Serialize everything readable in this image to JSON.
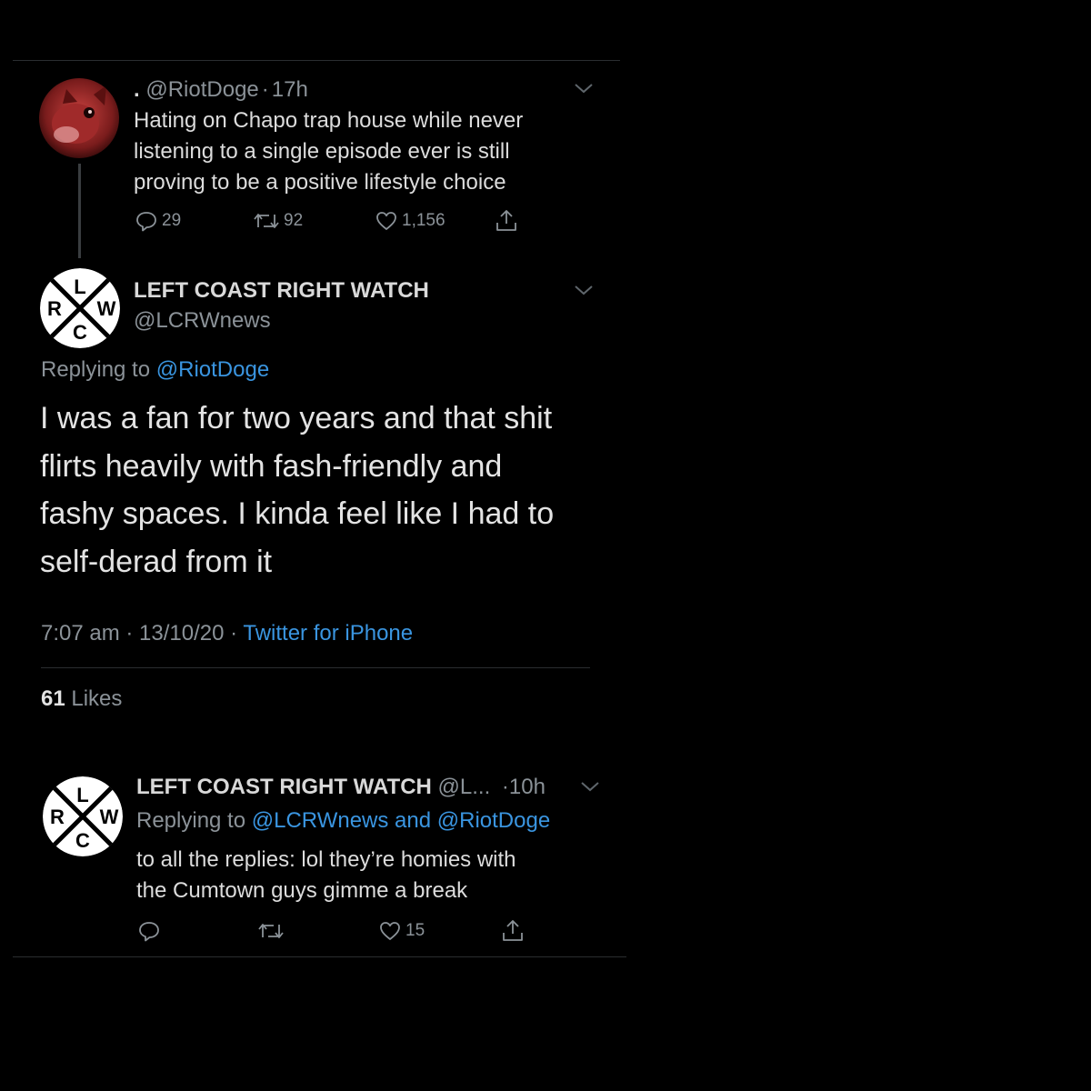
{
  "tweet1": {
    "display_name": ".",
    "handle": "@RiotDoge",
    "sep": "·",
    "time": "17h",
    "text_lines": [
      "Hating on Chapo trap house while never",
      "listening to a single episode ever is still",
      "proving to be a positive lifestyle choice"
    ],
    "replies": "29",
    "retweets": "92",
    "likes": "1,156"
  },
  "tweet2": {
    "display_name": "LEFT COAST RIGHT WATCH",
    "handle": "@LCRWnews",
    "replying_prefix": "Replying to",
    "replying_handle": "@RiotDoge",
    "text_lines": [
      "I was a fan for two years and that shit",
      "flirts heavily with fash-friendly and",
      "fashy spaces. I kinda feel like I had to",
      "self-derad from it"
    ],
    "timestamp": "7:07 am · 13/10/20 ·",
    "source": "Twitter for iPhone",
    "like_count": "61",
    "like_label": "Likes"
  },
  "tweet3": {
    "display_name": "LEFT COAST RIGHT WATCH",
    "handle": "@L...",
    "sep": "·",
    "time": "10h",
    "replying_prefix": "Replying to",
    "replying_handles": "@LCRWnews and @RiotDoge",
    "text_lines": [
      "to all the replies: lol they’re homies with",
      "the Cumtown guys gimme a break"
    ],
    "likes": "15"
  },
  "logo": {
    "letters": [
      "L",
      "R",
      "W",
      "C"
    ]
  },
  "colors": {
    "background": "#000000",
    "text": "#d9d9d9",
    "muted": "#8b9298",
    "link": "#3a95e0",
    "divider": "#2a2d30"
  }
}
